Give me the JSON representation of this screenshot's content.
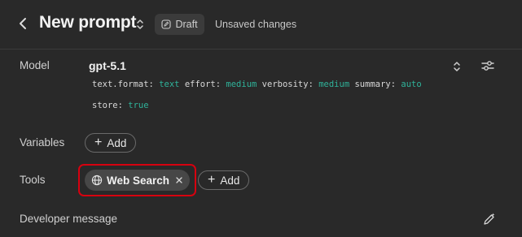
{
  "header": {
    "title": "New prompt",
    "status_badge": "Draft",
    "unsaved_text": "Unsaved changes"
  },
  "model": {
    "label": "Model",
    "name": "gpt-5.1",
    "params_line1": [
      {
        "key": "text.format:",
        "value": "text"
      },
      {
        "key": "effort:",
        "value": "medium"
      },
      {
        "key": "verbosity:",
        "value": "medium"
      },
      {
        "key": "summary:",
        "value": "auto"
      }
    ],
    "params_line2": [
      {
        "key": "store:",
        "value": "true"
      }
    ]
  },
  "variables": {
    "label": "Variables",
    "add_label": "Add"
  },
  "tools": {
    "label": "Tools",
    "items": [
      {
        "label": "Web Search",
        "icon": "globe-icon"
      }
    ],
    "add_label": "Add"
  },
  "developer": {
    "label": "Developer message"
  },
  "colors": {
    "background": "#292929",
    "value_accent": "#2fb39a",
    "highlight": "#d7000f"
  }
}
